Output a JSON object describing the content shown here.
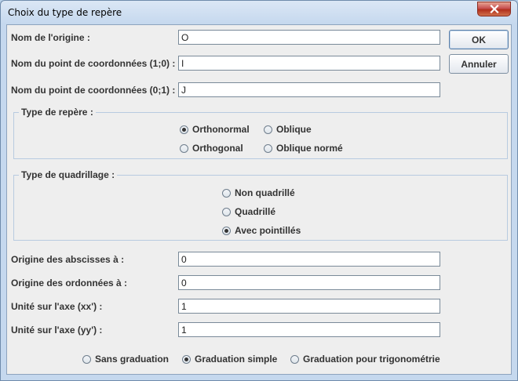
{
  "window": {
    "title": "Choix du type de repère"
  },
  "buttons": {
    "ok": "OK",
    "cancel": "Annuler"
  },
  "names": {
    "origin_label": "Nom de l'origine :",
    "origin_value": "O",
    "point_x_label": "Nom du point de coordonnées (1;0) :",
    "point_x_value": "I",
    "point_y_label": "Nom du point de coordonnées (0;1) :",
    "point_y_value": "J"
  },
  "frame_type": {
    "title": "Type de repère :",
    "options": [
      {
        "label": "Orthonormal",
        "selected": true
      },
      {
        "label": "Oblique",
        "selected": false
      },
      {
        "label": "Orthogonal",
        "selected": false
      },
      {
        "label": "Oblique normé",
        "selected": false
      }
    ]
  },
  "grid_type": {
    "title": "Type de quadrillage :",
    "options": [
      {
        "label": "Non quadrillé",
        "selected": false
      },
      {
        "label": "Quadrillé",
        "selected": false
      },
      {
        "label": "Avec pointillés",
        "selected": true
      }
    ]
  },
  "axes": {
    "abscissa_origin_label": "Origine des abscisses à :",
    "abscissa_origin_value": "0",
    "ordinate_origin_label": "Origine des ordonnées à :",
    "ordinate_origin_value": "0",
    "unit_x_label": "Unité sur l'axe (xx') :",
    "unit_x_value": "1",
    "unit_y_label": "Unité sur l'axe (yy') :",
    "unit_y_value": "1"
  },
  "graduation": {
    "options": [
      {
        "label": "Sans graduation",
        "selected": false
      },
      {
        "label": "Graduation simple",
        "selected": true
      },
      {
        "label": "Graduation pour trigonométrie",
        "selected": false
      }
    ]
  },
  "icons": {
    "close": "close-icon"
  }
}
